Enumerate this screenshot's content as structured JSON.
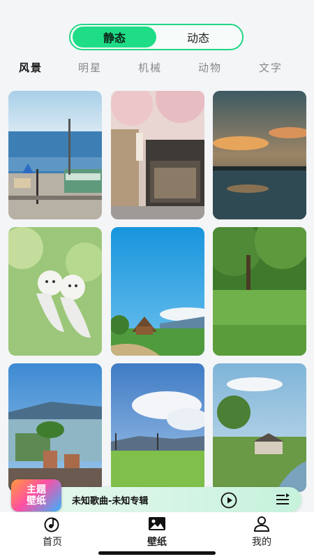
{
  "mode_toggle": {
    "static_label": "静态",
    "dynamic_label": "动态",
    "selected": "静态",
    "accent": "#1fdd87"
  },
  "categories": [
    {
      "label": "风景",
      "active": true
    },
    {
      "label": "明星",
      "active": false
    },
    {
      "label": "机械",
      "active": false
    },
    {
      "label": "动物",
      "active": false
    },
    {
      "label": "文字",
      "active": false
    }
  ],
  "wallpapers": [
    {
      "name": "seaside-railway-crossing"
    },
    {
      "name": "cherry-blossom-street"
    },
    {
      "name": "sunset-lake-reflection"
    },
    {
      "name": "teru-teru-bozu-dolls"
    },
    {
      "name": "village-under-blue-sky"
    },
    {
      "name": "green-tree-meadow"
    },
    {
      "name": "rooftop-flower-pots"
    },
    {
      "name": "rice-field-clouds"
    },
    {
      "name": "countryside-river-village"
    }
  ],
  "player": {
    "badge_line1": "主题",
    "badge_line2": "壁纸",
    "song": "未知歌曲-未知专辑",
    "play_icon": "play-circle-icon",
    "playlist_icon": "playlist-icon"
  },
  "tabbar": {
    "items": [
      {
        "label": "首页",
        "icon": "music-note-icon",
        "active": false
      },
      {
        "label": "壁纸",
        "icon": "image-icon",
        "active": true
      },
      {
        "label": "我的",
        "icon": "person-icon",
        "active": false
      }
    ]
  }
}
